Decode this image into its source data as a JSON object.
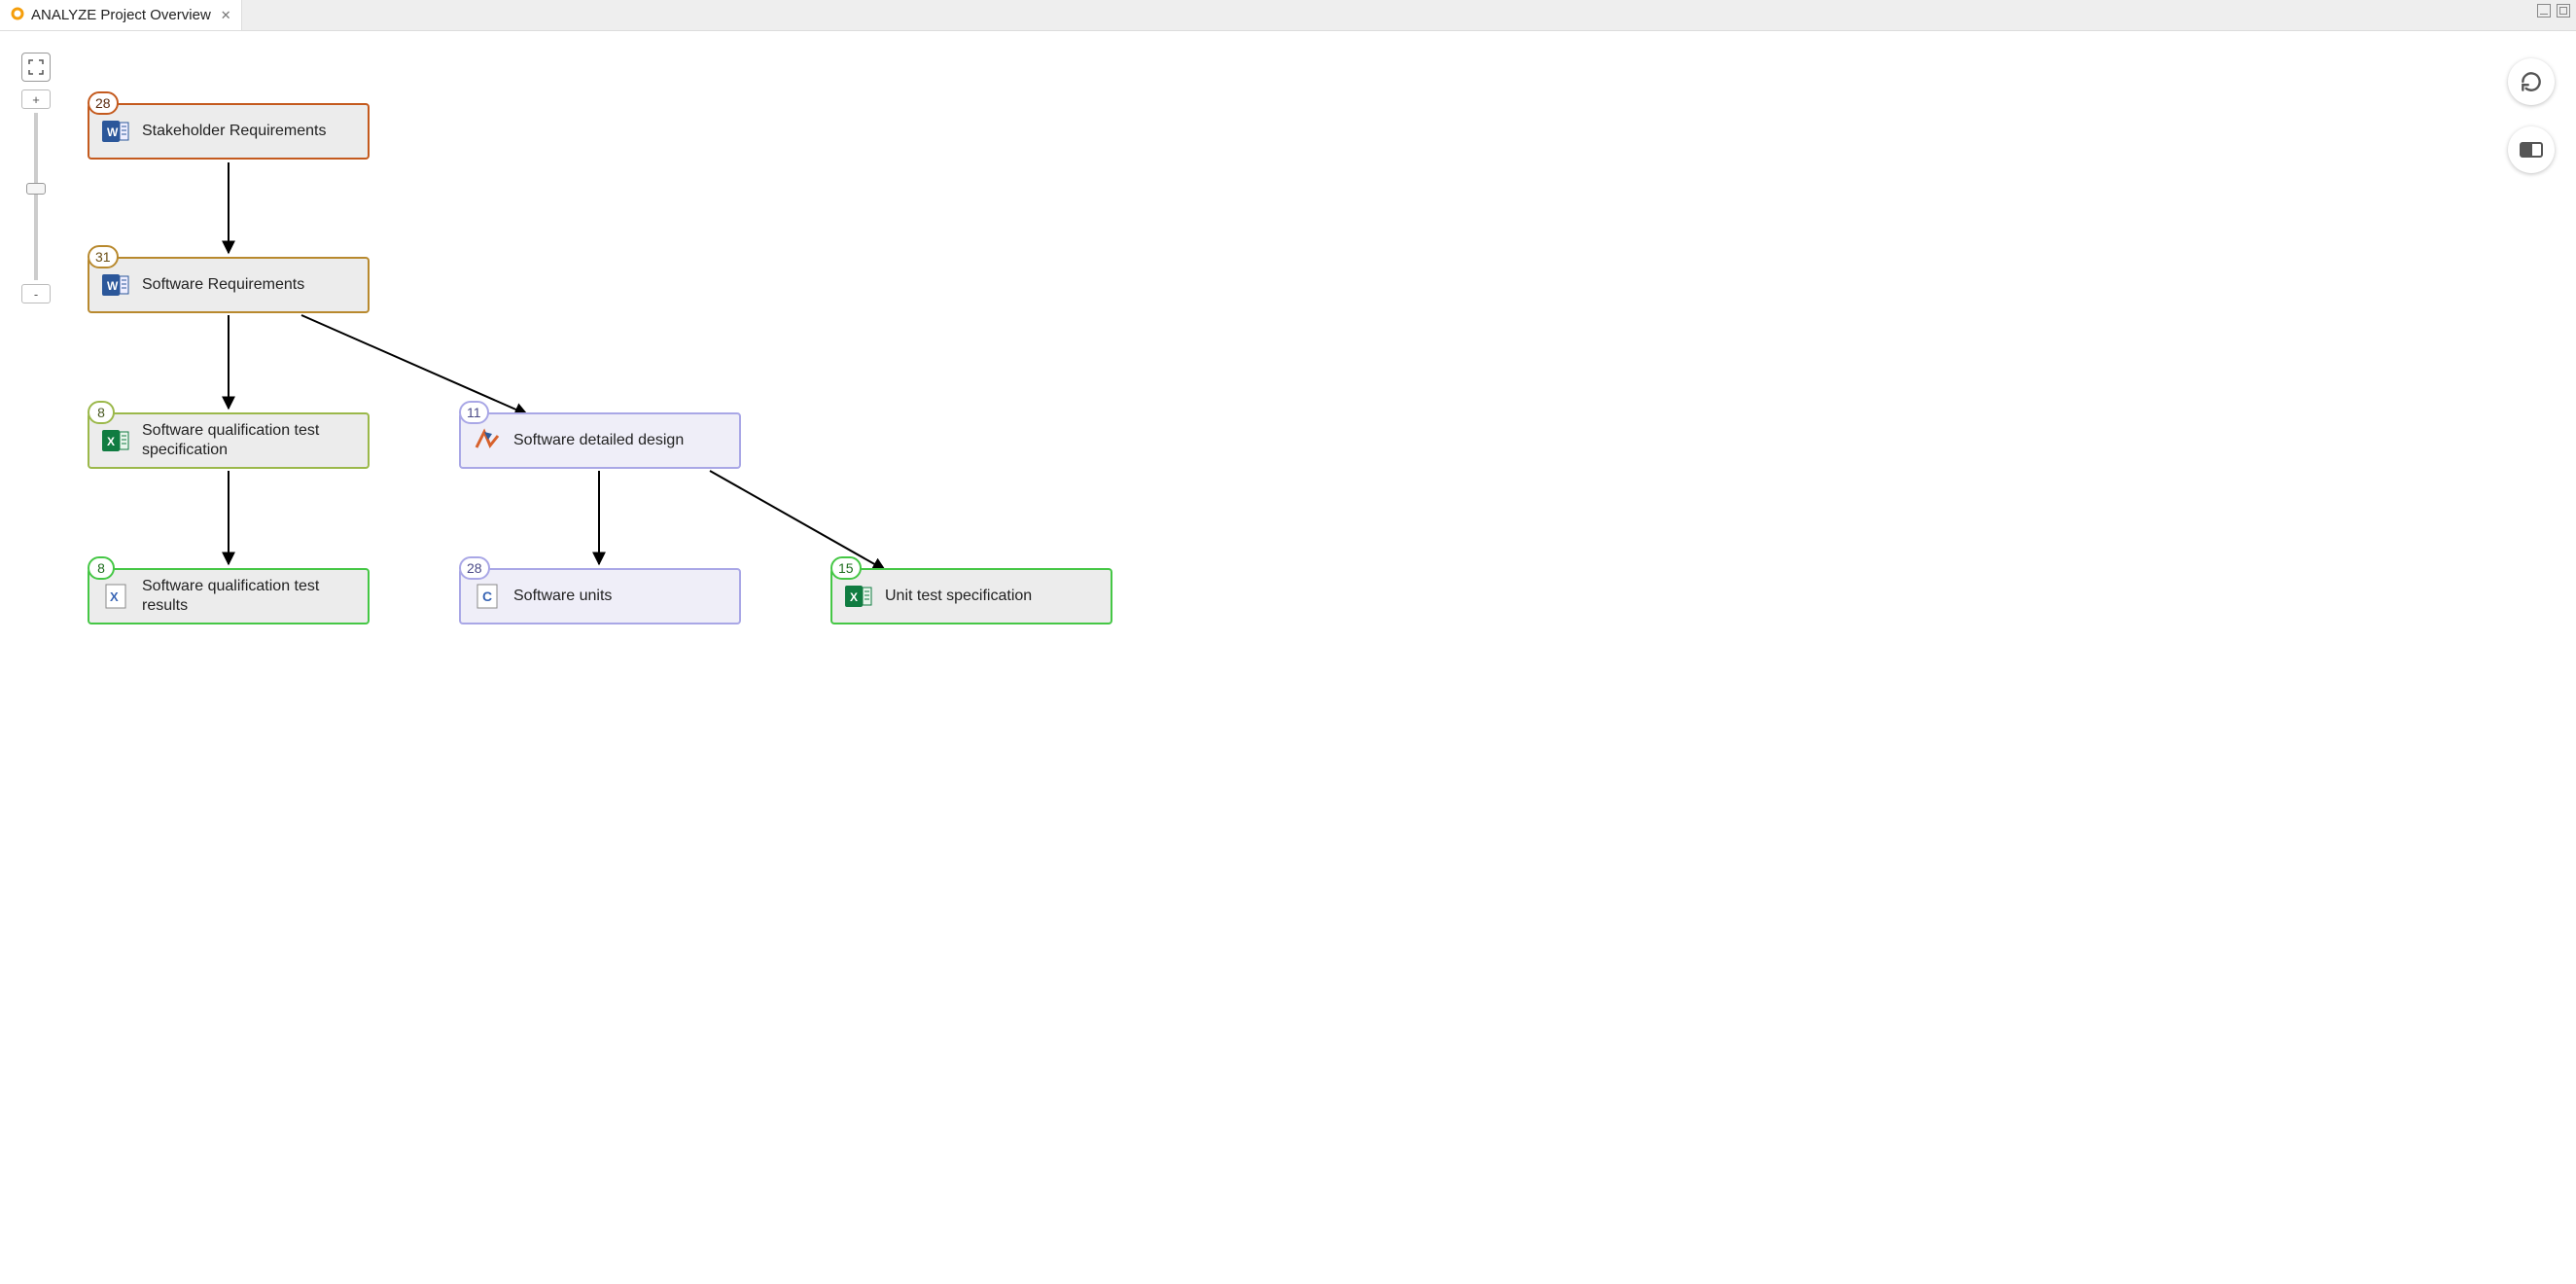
{
  "tab": {
    "title": "ANALYZE Project Overview"
  },
  "nodes": {
    "stakeholder_req": {
      "label": "Stakeholder Requirements",
      "badge": "28"
    },
    "software_req": {
      "label": "Software Requirements",
      "badge": "31"
    },
    "sq_test_spec": {
      "label": "Software qualification test specification",
      "badge": "8"
    },
    "detailed_design": {
      "label": "Software detailed design",
      "badge": "11"
    },
    "sq_test_results": {
      "label": "Software qualification test results",
      "badge": "8"
    },
    "software_units": {
      "label": "Software units",
      "badge": "28"
    },
    "unit_test_spec": {
      "label": "Unit test specification",
      "badge": "15"
    }
  },
  "colors": {
    "brown": "#c45a1e",
    "gold": "#b8892e",
    "olive": "#9bb84a",
    "green": "#45c745",
    "violet": "#a9a7e6"
  }
}
